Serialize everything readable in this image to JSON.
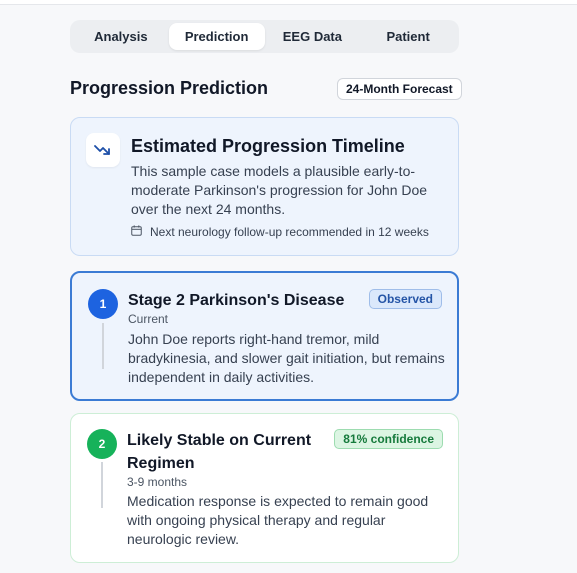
{
  "tabs": [
    {
      "label": "Analysis",
      "active": false
    },
    {
      "label": "Prediction",
      "active": true
    },
    {
      "label": "EEG Data",
      "active": false
    },
    {
      "label": "Patient",
      "active": false
    }
  ],
  "section": {
    "title": "Progression Prediction",
    "forecast_label": "24-Month Forecast"
  },
  "timeline": {
    "icon": "trend-down-icon",
    "title": "Estimated Progression Timeline",
    "description": "This sample case models a plausible early-to-moderate Parkinson's progression for John Doe over the next 24 months.",
    "followup_icon": "calendar-icon",
    "followup": "Next neurology follow-up recommended in 12 weeks"
  },
  "stages": [
    {
      "number": "1",
      "title": "Stage 2 Parkinson's Disease",
      "timeframe": "Current",
      "badge": "Observed",
      "body": "John Doe reports right-hand tremor, mild bradykinesia, and slower gait initiation, but remains independent in daily activities."
    },
    {
      "number": "2",
      "title": "Likely Stable on Current Regimen",
      "timeframe": "3-9 months",
      "badge": "81% confidence",
      "body": "Medication response is expected to remain good with ongoing physical therapy and regular neurologic review."
    }
  ],
  "colors": {
    "accent_blue": "#1d63e0",
    "accent_green": "#16b25a"
  }
}
